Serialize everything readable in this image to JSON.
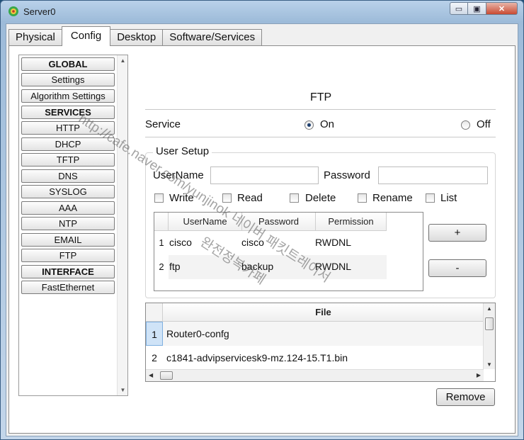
{
  "window": {
    "title": "Server0",
    "caption": {
      "minimize": "▭",
      "maximize": "▣",
      "close": "✕"
    }
  },
  "tabs": [
    "Physical",
    "Config",
    "Desktop",
    "Software/Services"
  ],
  "sidebar": {
    "items": [
      "GLOBAL",
      "Settings",
      "Algorithm Settings",
      "SERVICES",
      "HTTP",
      "DHCP",
      "TFTP",
      "DNS",
      "SYSLOG",
      "AAA",
      "NTP",
      "EMAIL",
      "FTP",
      "INTERFACE",
      "FastEthernet"
    ]
  },
  "ftp": {
    "title": "FTP",
    "service_label": "Service",
    "on_label": "On",
    "off_label": "Off",
    "service_state": "On",
    "user_setup": {
      "legend": "User Setup",
      "username_label": "UserName",
      "username_value": "",
      "password_label": "Password",
      "password_value": "",
      "permissions": [
        "Write",
        "Read",
        "Delete",
        "Rename",
        "List"
      ],
      "columns": [
        "UserName",
        "Password",
        "Permission"
      ],
      "rows": [
        {
          "num": "1",
          "username": "cisco",
          "password": "cisco",
          "permission": "RWDNL"
        },
        {
          "num": "2",
          "username": "ftp",
          "password": "backup",
          "permission": "RWDNL"
        }
      ],
      "add_button": "+",
      "remove_user_button": "-"
    },
    "files": {
      "header": "File",
      "rows": [
        {
          "num": "1",
          "name": "Router0-confg"
        },
        {
          "num": "2",
          "name": "c1841-advipservicesk9-mz.124-15.T1.bin"
        }
      ]
    },
    "remove_button": "Remove"
  },
  "watermark": {
    "line1": "http://cafe.naver.com/yunjinok 네이버 패킷트레이서",
    "line2": "완전정복카페"
  }
}
